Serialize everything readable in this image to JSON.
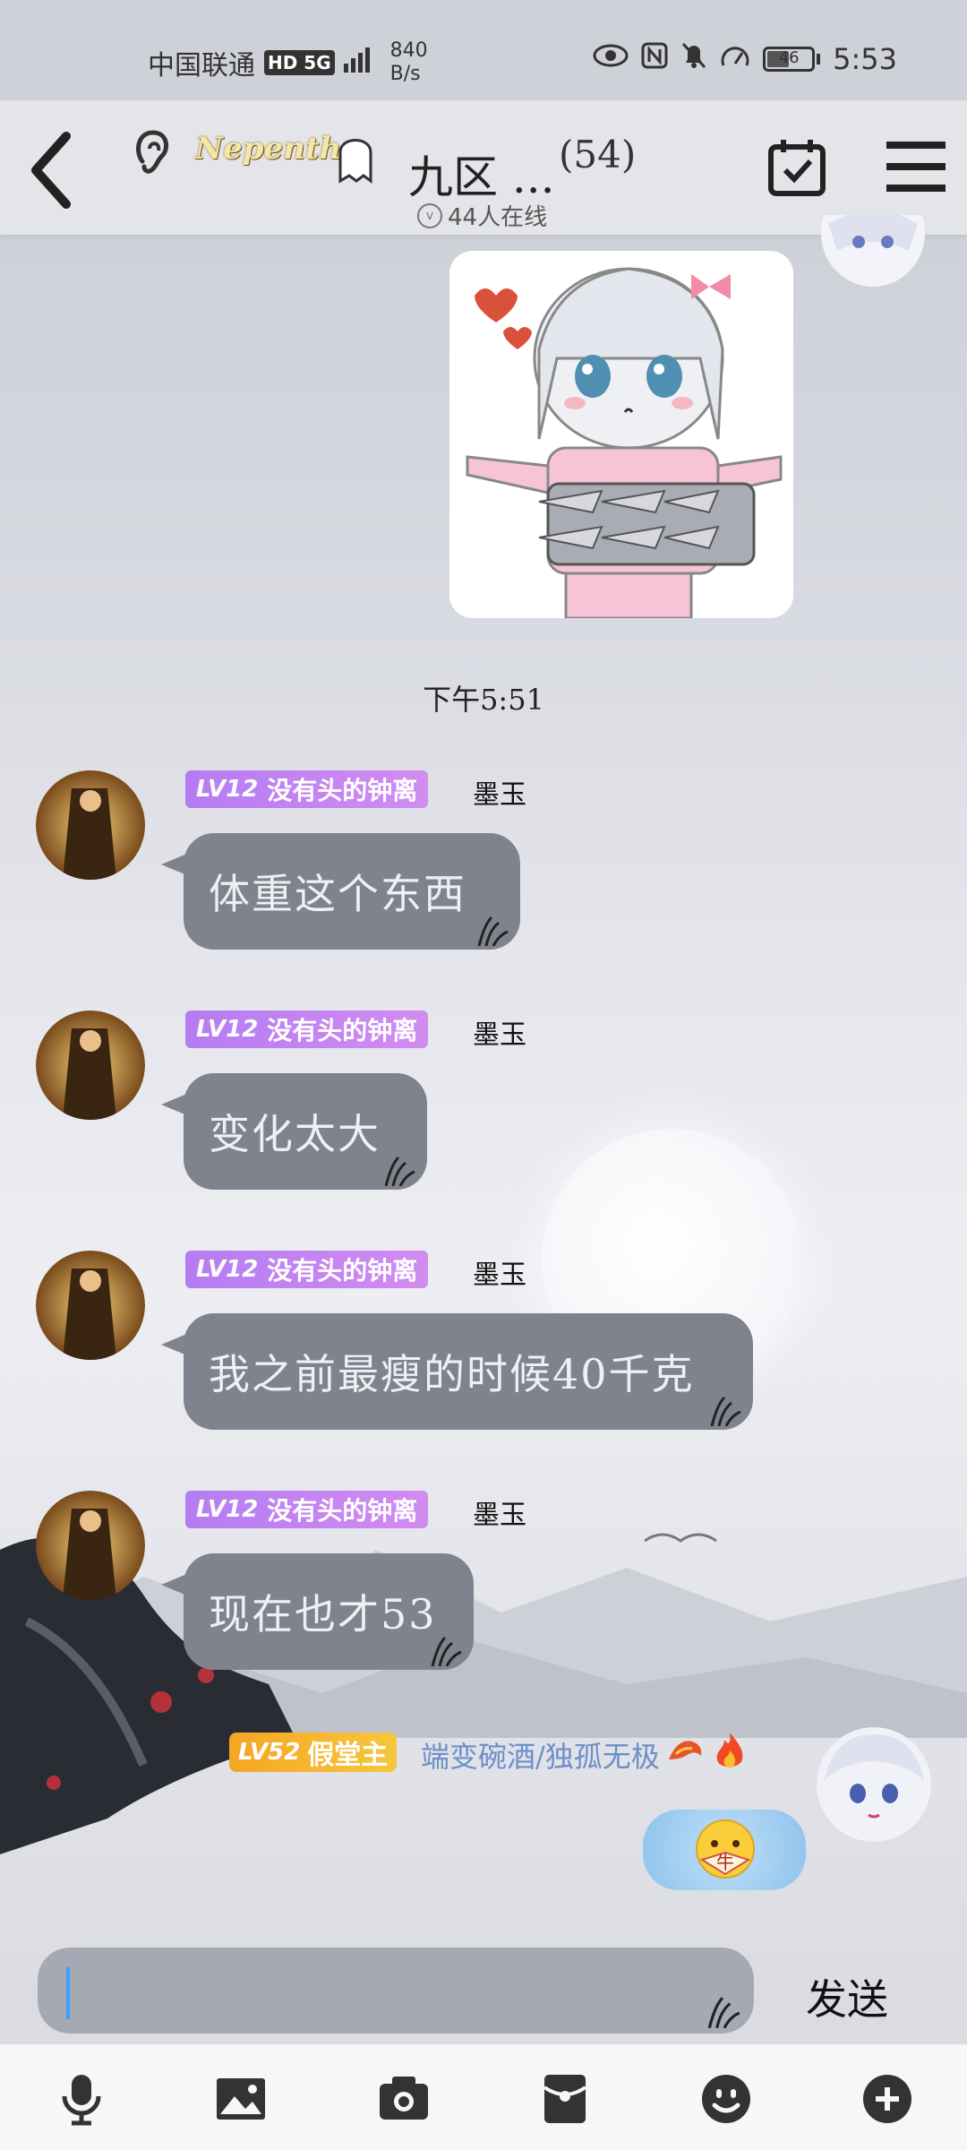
{
  "status_bar": {
    "carrier": "中国联通",
    "network": "HD 5G",
    "speed": "840",
    "speed_unit": "B/s",
    "battery": "46",
    "time": "5:53"
  },
  "header": {
    "tag_text": "Nepenthe",
    "title": "九区 ...",
    "member_count": "(54)",
    "online_text": "44人在线"
  },
  "timestamp": "下午5:51",
  "messages": [
    {
      "level": "LV12",
      "title": "没有头的钟离",
      "nickname": "墨玉",
      "text": "体重这个东西"
    },
    {
      "level": "LV12",
      "title": "没有头的钟离",
      "nickname": "墨玉",
      "text": "变化太大"
    },
    {
      "level": "LV12",
      "title": "没有头的钟离",
      "nickname": "墨玉",
      "text": "我之前最瘦的时候40千克"
    },
    {
      "level": "LV12",
      "title": "没有头的钟离",
      "nickname": "墨玉",
      "text": "现在也才53"
    }
  ],
  "self_message": {
    "level": "LV52",
    "title": "假堂主",
    "nickname": "端变碗酒/独孤无极",
    "emoji_label": "牛"
  },
  "composer": {
    "input_value": "",
    "send_label": "发送"
  },
  "toolbar_icons": [
    "microphone-icon",
    "image-icon",
    "camera-icon",
    "red-packet-icon",
    "emoji-icon",
    "plus-icon"
  ],
  "colors": {
    "bubble": "#80838d",
    "badge_purple": "#c184f2",
    "badge_gold": "#f5a623",
    "caret": "#3aa0ff"
  }
}
